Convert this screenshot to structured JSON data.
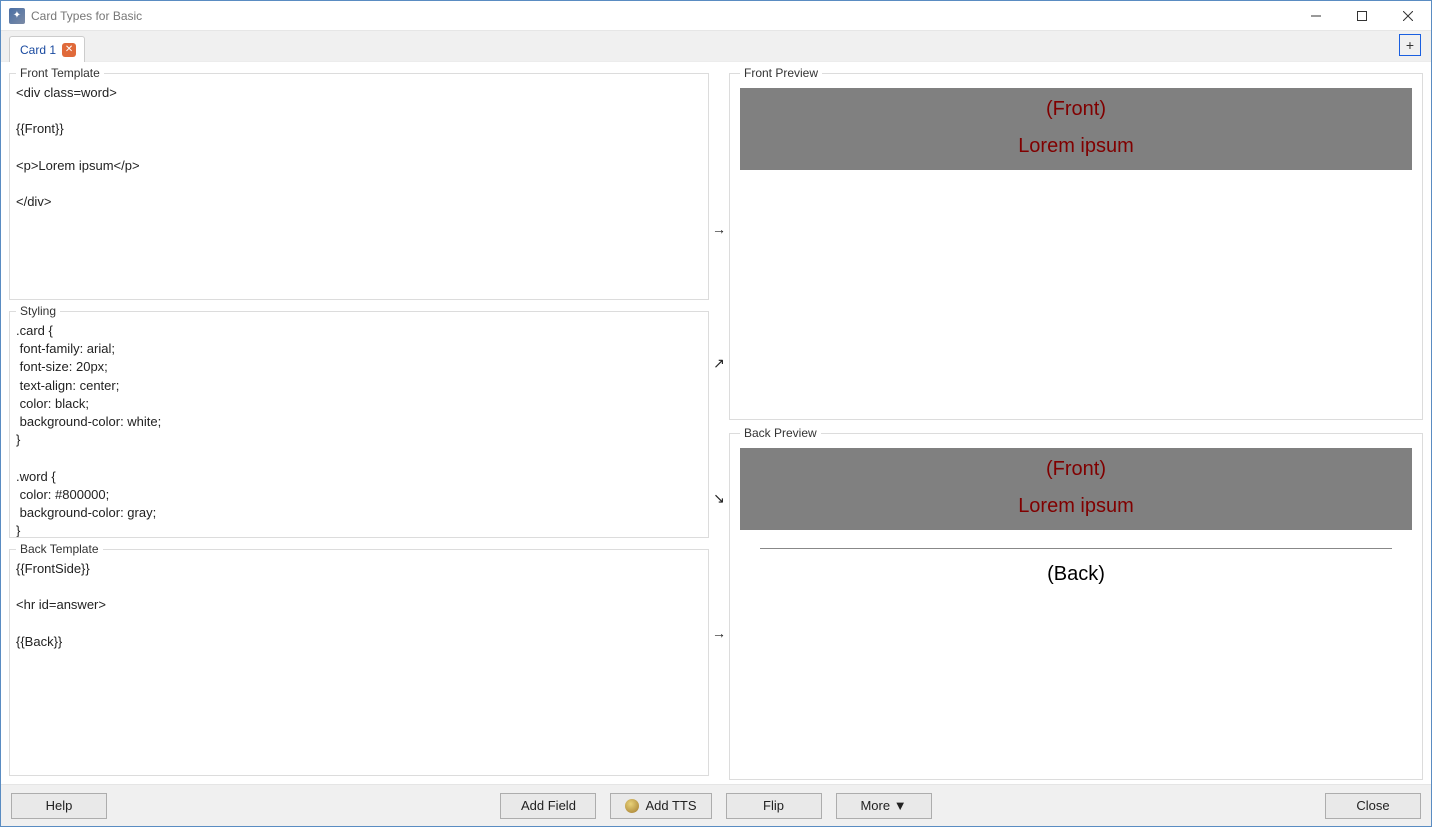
{
  "window": {
    "title": "Card Types for Basic"
  },
  "tabs": {
    "items": [
      {
        "label": "Card 1"
      }
    ],
    "add_label": "+"
  },
  "editors": {
    "front": {
      "legend": "Front Template",
      "content": "<div class=word>\n\n{{Front}}\n\n<p>Lorem ipsum</p>\n\n</div>"
    },
    "styling": {
      "legend": "Styling",
      "content": ".card {\n font-family: arial;\n font-size: 20px;\n text-align: center;\n color: black;\n background-color: white;\n}\n\n.word {\n color: #800000;\n background-color: gray;\n}"
    },
    "back": {
      "legend": "Back Template",
      "content": "{{FrontSide}}\n\n<hr id=answer>\n\n{{Back}}"
    }
  },
  "preview": {
    "front": {
      "legend": "Front Preview",
      "front_placeholder": "(Front)",
      "lorem": "Lorem ipsum"
    },
    "back": {
      "legend": "Back Preview",
      "front_placeholder": "(Front)",
      "lorem": "Lorem ipsum",
      "back_placeholder": "(Back)"
    }
  },
  "footer": {
    "help": "Help",
    "add_field": "Add Field",
    "add_tts": "Add TTS",
    "flip": "Flip",
    "more": "More ▼",
    "close": "Close"
  },
  "arrows": {
    "right": "→",
    "ne": "↗",
    "se": "↘"
  }
}
